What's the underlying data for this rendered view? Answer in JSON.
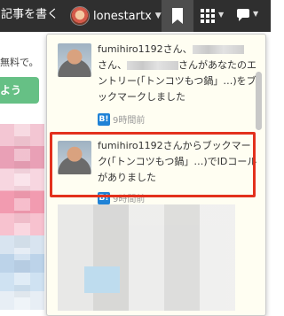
{
  "header": {
    "write_label": "記事を書く",
    "username": "lonestartx",
    "bookmark_icon": "bookmark-icon",
    "apps_icon": "grid-icon",
    "chat_icon": "chat-icon"
  },
  "background": {
    "text": "無料で。",
    "button_label": "よう"
  },
  "notifications": [
    {
      "part1": "fumihiro1192さん、",
      "part2": "さん、",
      "part3": "さんがあなたのエントリー(「トンコツもつ鍋」…)をブックマークしました",
      "badge": "B!",
      "time": "9時間前"
    },
    {
      "text": "fumihiro1192さんからブックマーク(「トンコツもつ鍋」…)でIDコールがありました",
      "badge": "B!",
      "time": "9時間前"
    }
  ],
  "colors": {
    "topbar": "#2f2f2f",
    "highlight": "#e3311d",
    "badge": "#1f82d6",
    "panel": "#fffef2"
  }
}
